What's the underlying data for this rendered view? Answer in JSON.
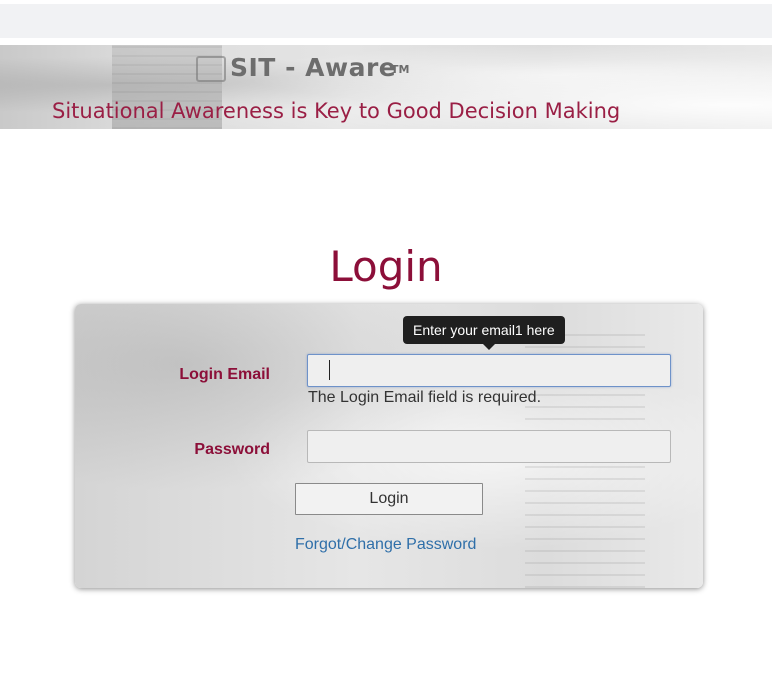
{
  "header": {
    "app_title": "SIT - Aware",
    "trademark": "TM",
    "tagline": "Situational Awareness is Key to Good Decision Making"
  },
  "login": {
    "heading": "Login",
    "email_label": "Login Email",
    "email_value": "",
    "email_tooltip": "Enter your email1 here",
    "email_error": "The Login Email field is required.",
    "password_label": "Password",
    "password_value": "",
    "submit_label": "Login",
    "forgot_link": "Forgot/Change Password"
  },
  "colors": {
    "brand": "#8c0f39",
    "tagline": "#9a1f45",
    "link": "#2f6fa9",
    "focus_border": "#6e92c9"
  }
}
